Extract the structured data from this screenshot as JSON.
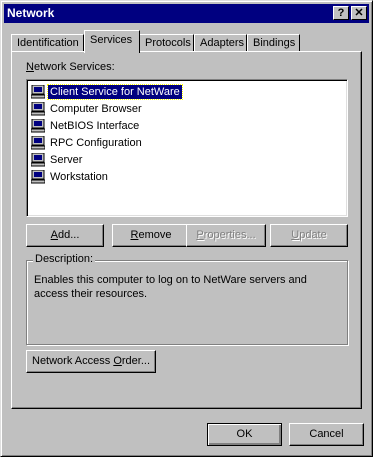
{
  "window": {
    "title": "Network"
  },
  "titlebar": {
    "help_label": "?",
    "close_label": "✕"
  },
  "tabs": [
    {
      "label": "Identification"
    },
    {
      "label": "Services"
    },
    {
      "label": "Protocols"
    },
    {
      "label": "Adapters"
    },
    {
      "label": "Bindings"
    }
  ],
  "services_tab": {
    "list_label_hotkey": "N",
    "list_label_rest": "etwork Services:",
    "services": [
      {
        "name": "Client Service for NetWare",
        "selected": true,
        "icon": "computer-icon"
      },
      {
        "name": "Computer Browser",
        "icon": "computer-icon"
      },
      {
        "name": "NetBIOS Interface",
        "icon": "computer-icon"
      },
      {
        "name": "RPC Configuration",
        "icon": "computer-icon"
      },
      {
        "name": "Server",
        "icon": "computer-icon"
      },
      {
        "name": "Workstation",
        "icon": "computer-icon"
      }
    ],
    "buttons": {
      "add": {
        "hotkey": "A",
        "rest": "dd..."
      },
      "remove": {
        "hotkey": "R",
        "rest": "emove"
      },
      "properties": {
        "hotkey": "P",
        "rest": "roperties..."
      },
      "update": {
        "hotkey": "U",
        "rest": "pdate"
      }
    },
    "description_title": "Description:",
    "description_text": "Enables this computer to log on to NetWare servers and access their resources.",
    "network_access_order": {
      "before": "Network Access ",
      "hotkey": "O",
      "after": "rder..."
    }
  },
  "footer": {
    "ok_label": "OK",
    "cancel_label": "Cancel"
  }
}
